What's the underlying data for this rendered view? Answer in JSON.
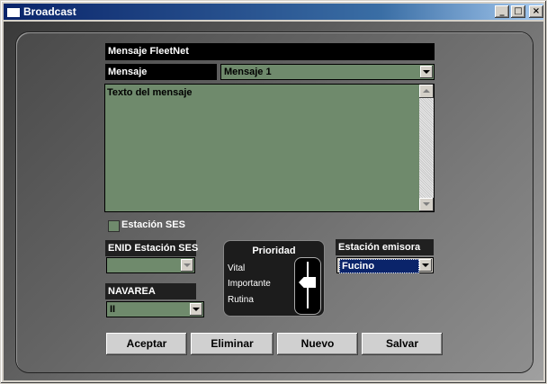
{
  "window": {
    "title": "Broadcast",
    "controls": {
      "minimize": "_",
      "maximize": "□",
      "close": "×"
    }
  },
  "form": {
    "header": "Mensaje FleetNet",
    "mensaje_label": "Mensaje",
    "mensaje_value": "Mensaje 1",
    "text_label": "Texto del mensaje",
    "estacion_ses_label": "Estación SES",
    "estacion_ses_checked": false,
    "enid_label": "ENID Estación SES",
    "enid_value": "",
    "navarea_label": "NAVAREA",
    "navarea_value": "II",
    "priority": {
      "title": "Prioridad",
      "options": [
        "Vital",
        "Importante",
        "Rutina"
      ],
      "selected": "Importante"
    },
    "estacion_emisora_label": "Estación emisora",
    "estacion_emisora_value": "Fucino"
  },
  "buttons": {
    "accept": "Aceptar",
    "delete": "Eliminar",
    "new": "Nuevo",
    "save": "Salvar"
  },
  "colors": {
    "field_green": "#6f8a6c",
    "selection_blue": "#0a246a"
  }
}
